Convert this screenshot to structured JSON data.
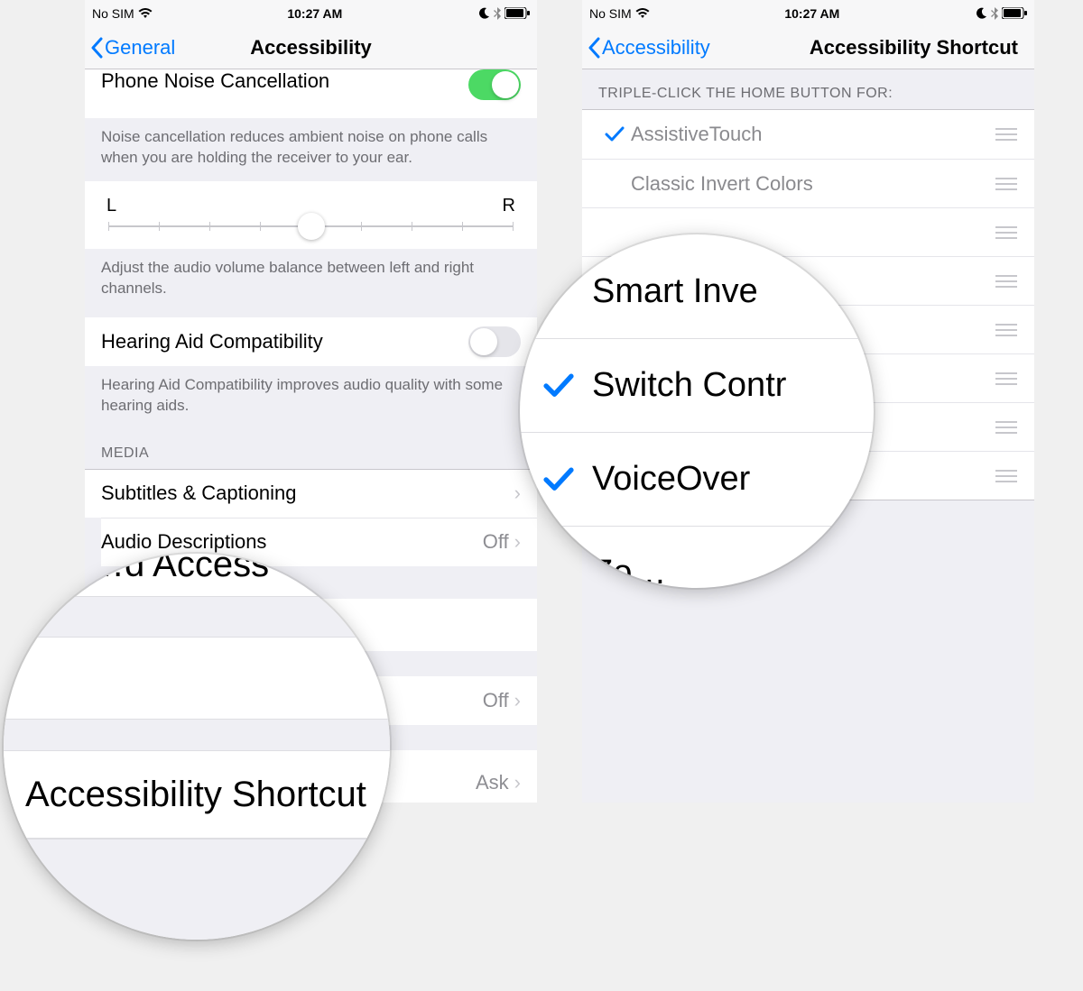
{
  "status": {
    "carrier": "No SIM",
    "time": "10:27 AM"
  },
  "left": {
    "back_label": "General",
    "title": "Accessibility",
    "phone_noise_cancel": "Phone Noise Cancellation",
    "noise_footer": "Noise cancellation reduces ambient noise on phone calls when you are holding the receiver to your ear.",
    "balance_L": "L",
    "balance_R": "R",
    "balance_footer": "Adjust the audio volume balance between left and right channels.",
    "hearing_aid": "Hearing Aid Compatibility",
    "hearing_footer": "Hearing Aid Compatibility improves audio quality with some hearing aids.",
    "media_header": "MEDIA",
    "subtitles": "Subtitles & Captioning",
    "audio_desc": "Audio Descriptions",
    "audio_desc_val": "Off",
    "row_off_val": "Off",
    "row_ask_val": "Ask",
    "mag_guided": "…d Access",
    "mag_shortcut": "Accessibility Shortcut"
  },
  "right": {
    "back_label": "Accessibility",
    "title": "Accessibility Shortcut",
    "section_header": "TRIPLE-CLICK THE HOME BUTTON FOR:",
    "items": [
      {
        "label": "AssistiveTouch",
        "checked": true
      },
      {
        "label": "Classic Invert Colors",
        "checked": false
      },
      {
        "label": "",
        "checked": false
      },
      {
        "label": "",
        "checked": false
      },
      {
        "label": "",
        "checked": false
      },
      {
        "label": "",
        "checked": false
      },
      {
        "label": "",
        "checked": false
      },
      {
        "label": "",
        "checked": false
      }
    ],
    "mag_items": [
      {
        "label": "Smart Inve",
        "checked": true
      },
      {
        "label": "Switch Contr",
        "checked": true
      },
      {
        "label": "VoiceOver",
        "checked": true
      },
      {
        "label": "Zo…",
        "checked": false
      }
    ]
  }
}
